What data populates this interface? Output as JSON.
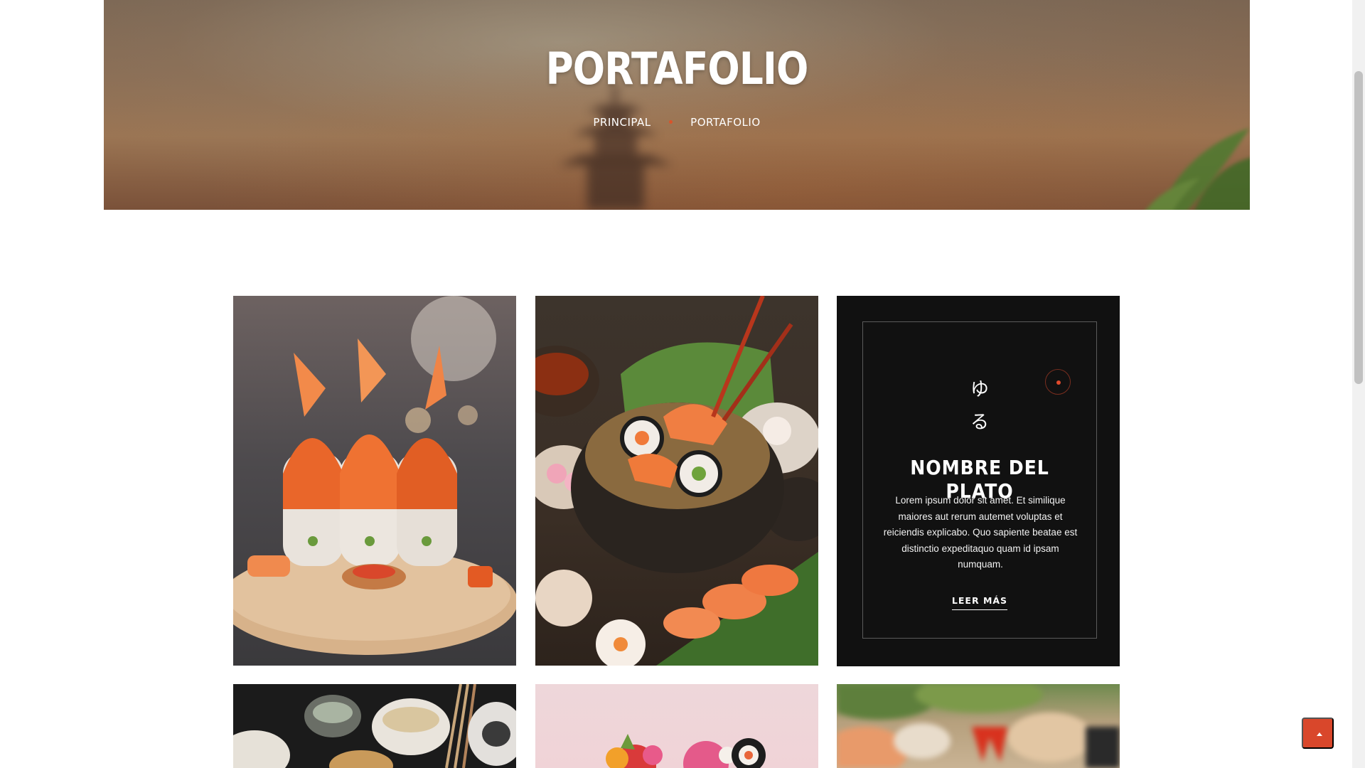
{
  "hero": {
    "title": "PORTAFOLIO",
    "breadcrumb": {
      "home": "PRINCIPAL",
      "current": "PORTAFOLIO"
    }
  },
  "portfolio": {
    "items": [
      {
        "type": "image",
        "icon": "salmon-sushi-photo"
      },
      {
        "type": "image",
        "icon": "sushi-bowl-photo"
      },
      {
        "type": "info",
        "kanji_top": "ゆ",
        "kanji_bottom": "る",
        "title": "NOMBRE DEL PLATO",
        "description": "Lorem ipsum dolor sit amet. Et similique maiores aut rerum autemet voluptas et reiciendis explicabo. Quo sapiente beatae est distinctio expeditaquo quam id ipsam numquam.",
        "link_label": "LEER MÁS"
      },
      {
        "type": "image",
        "icon": "noodle-set-photo"
      },
      {
        "type": "image",
        "icon": "flower-sushi-photo"
      },
      {
        "type": "image",
        "icon": "sushi-platter-photo"
      }
    ]
  },
  "colors": {
    "accent": "#d9472b",
    "card_dark": "#111111"
  }
}
